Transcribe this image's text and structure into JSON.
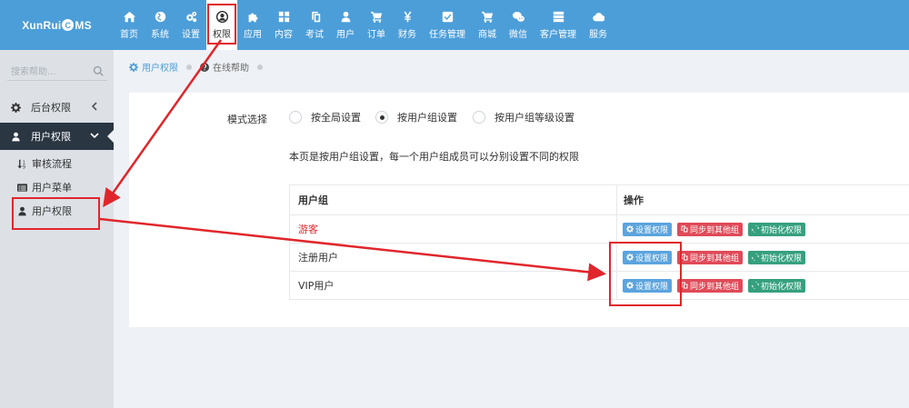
{
  "app": {
    "logo_pre": "XunRui",
    "logo_c": "C",
    "logo_post": "MS"
  },
  "nav": [
    {
      "label": "首页",
      "icon": "home-icon"
    },
    {
      "label": "系统",
      "icon": "globe-icon"
    },
    {
      "label": "设置",
      "icon": "cogs-icon"
    },
    {
      "label": "权限",
      "icon": "user-circle-icon",
      "active": true
    },
    {
      "label": "应用",
      "icon": "puzzle-icon"
    },
    {
      "label": "内容",
      "icon": "grid-icon"
    },
    {
      "label": "考试",
      "icon": "copy-icon"
    },
    {
      "label": "用户",
      "icon": "user-icon"
    },
    {
      "label": "订单",
      "icon": "cart-icon"
    },
    {
      "label": "财务",
      "icon": "yen-icon"
    },
    {
      "label": "任务管理",
      "icon": "checkbox-icon"
    },
    {
      "label": "商城",
      "icon": "cart-icon"
    },
    {
      "label": "微信",
      "icon": "wechat-icon"
    },
    {
      "label": "客户管理",
      "icon": "server-icon"
    },
    {
      "label": "服务",
      "icon": "cloud-icon"
    }
  ],
  "sidebar": {
    "search_placeholder": "搜索帮助...",
    "groups": [
      {
        "label": "后台权限",
        "icon": "cog-icon"
      },
      {
        "label": "用户权限",
        "icon": "user-icon"
      }
    ],
    "items": [
      {
        "label": "审核流程",
        "icon": "sort-icon"
      },
      {
        "label": "用户菜单",
        "icon": "list-icon"
      },
      {
        "label": "用户权限",
        "icon": "user-icon"
      }
    ]
  },
  "breadcrumb": [
    {
      "label": "用户权限",
      "icon": "cog-icon"
    },
    {
      "label": "在线帮助",
      "icon": "question-icon"
    }
  ],
  "form": {
    "mode_label": "模式选择",
    "options": [
      "按全局设置",
      "按用户组设置",
      "按用户组等级设置"
    ],
    "selected": "按用户组设置",
    "description": "本页是按用户组设置，每一个用户组成员可以分别设置不同的权限"
  },
  "table": {
    "headers": [
      "用户组",
      "操作"
    ],
    "rows": [
      {
        "name": "游客",
        "color": "#e0262b"
      },
      {
        "name": "注册用户",
        "color": "#333333"
      },
      {
        "name": "VIP用户",
        "color": "#333333"
      }
    ],
    "actions": {
      "set": "设置权限",
      "sync": "同步到其他组",
      "init": "初始化权限"
    }
  },
  "colors": {
    "topbar": "#4c9ed9",
    "annotation": "#e0262b",
    "btn_blue": "#5ba4de",
    "btn_red": "#e04a58",
    "btn_green": "#36a07e"
  }
}
